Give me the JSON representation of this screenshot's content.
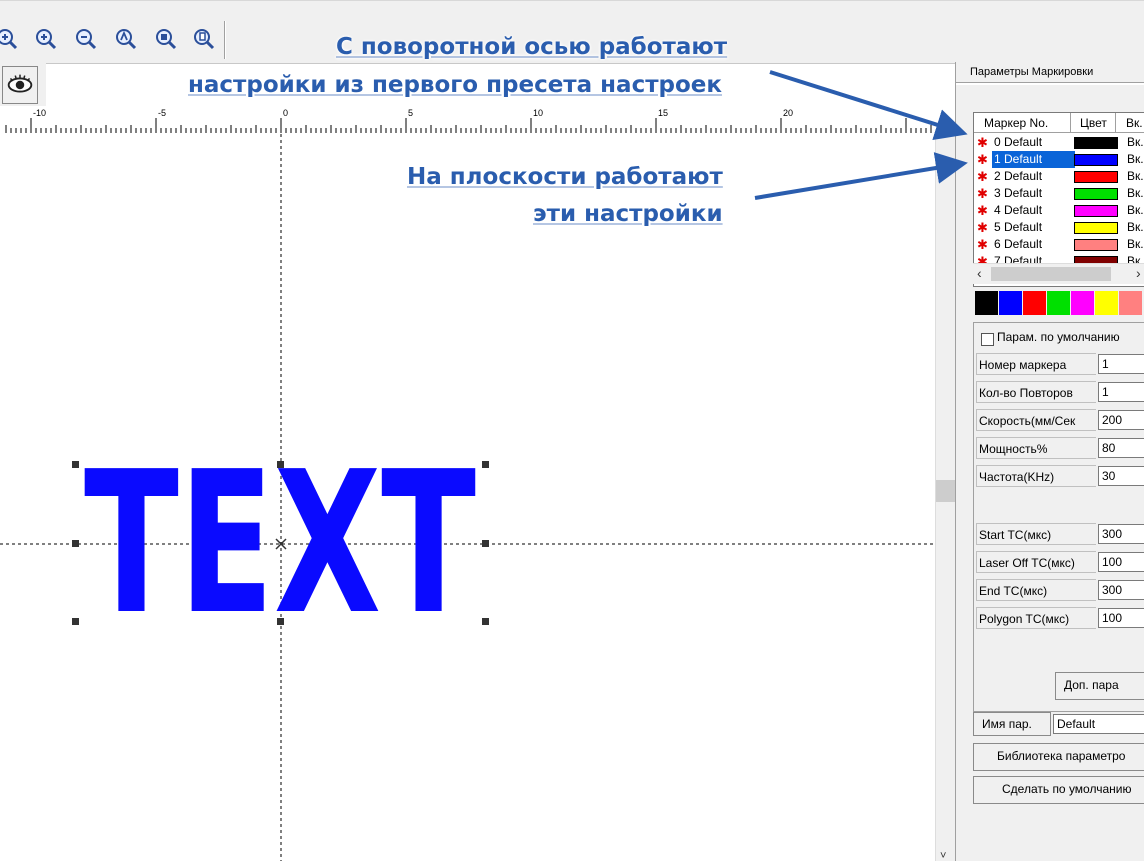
{
  "toolbar": {
    "buttons": [
      "zoom-fit-icon",
      "zoom-in-icon",
      "zoom-out-icon",
      "zoom-all-icon",
      "zoom-select-icon",
      "zoom-page-icon"
    ],
    "view_icon": "eye-icon"
  },
  "ruler": {
    "ticks": [
      "-10",
      "-5",
      "0",
      "5",
      "10",
      "15",
      "20"
    ]
  },
  "canvas": {
    "object_text": "TEXT",
    "object_color": "#0a0aff"
  },
  "annotations": {
    "top_line1": "С поворотной осью работают",
    "top_line2": "настройки из первого пресета настроек",
    "mid_line1": "На плоскости работают",
    "mid_line2": "эти настройки",
    "color": "#2a5dae"
  },
  "panel": {
    "title": "Параметры Маркировки",
    "columns": [
      "Маркер No.",
      "Цвет",
      "Вк."
    ],
    "markers": [
      {
        "name": "0 Default",
        "color": "#000000",
        "enabled": "Вк.",
        "selected": false
      },
      {
        "name": "1 Default",
        "color": "#0000ff",
        "enabled": "Вк.",
        "selected": true
      },
      {
        "name": "2 Default",
        "color": "#ff0000",
        "enabled": "Вк.",
        "selected": false
      },
      {
        "name": "3 Default",
        "color": "#00e000",
        "enabled": "Вк.",
        "selected": false
      },
      {
        "name": "4 Default",
        "color": "#ff00ff",
        "enabled": "Вк.",
        "selected": false
      },
      {
        "name": "5 Default",
        "color": "#ffff00",
        "enabled": "Вк.",
        "selected": false
      },
      {
        "name": "6 Default",
        "color": "#ff8080",
        "enabled": "Вк.",
        "selected": false
      },
      {
        "name": "7 Default",
        "color": "#800000",
        "enabled": "Вк.",
        "selected": false
      }
    ],
    "palette": [
      "#000000",
      "#0000ff",
      "#ff0000",
      "#00e000",
      "#ff00ff",
      "#ffff00",
      "#ff8080"
    ],
    "default_checkbox": "Парам. по умолчанию",
    "fields": [
      {
        "label": "Номер маркера",
        "value": "1"
      },
      {
        "label": "Кол-во Повторов",
        "value": "1"
      },
      {
        "label": "Скорость(мм/Сек",
        "value": "200"
      },
      {
        "label": "Мощность%",
        "value": "80"
      },
      {
        "label": "Частота(KHz)",
        "value": "30"
      },
      {
        "label": "Start TC(мкс)",
        "value": "300"
      },
      {
        "label": "Laser Off TC(мкс)",
        "value": "100"
      },
      {
        "label": "End TC(мкс)",
        "value": "300"
      },
      {
        "label": "Polygon TC(мкс)",
        "value": "100"
      }
    ],
    "extra_params_button": "Доп. пара",
    "param_name_label": "Имя пар.",
    "param_name_value": "Default",
    "library_button": "Библиотека параметро",
    "make_default_button": "Сделать по умолчанию"
  }
}
